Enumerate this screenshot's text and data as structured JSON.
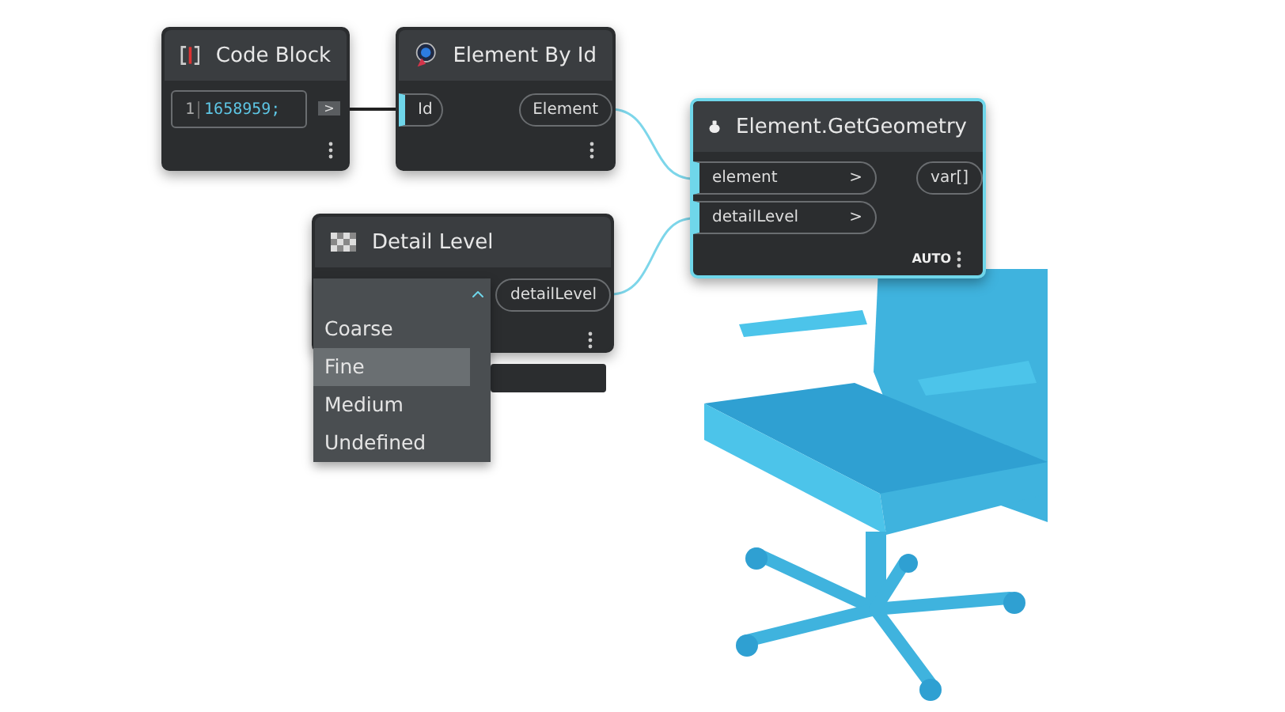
{
  "nodes": [
    {
      "kind": "code_block",
      "title": "Code Block",
      "selected": false,
      "line_number": "1",
      "code": "1658959;",
      "output": ">"
    },
    {
      "kind": "element_by_id",
      "title": "Element By Id",
      "selected": false,
      "inputs": [
        {
          "label": "Id",
          "connected": true
        }
      ],
      "outputs": [
        "Element"
      ]
    },
    {
      "kind": "get_geometry",
      "title": "Element.GetGeometry",
      "selected": true,
      "inputs": [
        {
          "label": "element",
          "arrow": ">",
          "connected": true
        },
        {
          "label": "detailLevel",
          "arrow": ">",
          "connected": true
        }
      ],
      "outputs": [
        "var[]"
      ],
      "lacing": "AUTO"
    },
    {
      "kind": "dropdown",
      "title": "Detail Level",
      "selected": false,
      "outputs": [
        "detailLevel"
      ],
      "expanded": true,
      "options": [
        {
          "label": "Coarse",
          "selected": false
        },
        {
          "label": "Fine",
          "selected": true
        },
        {
          "label": "Medium",
          "selected": false
        },
        {
          "label": "Undefined",
          "selected": false
        }
      ]
    }
  ]
}
